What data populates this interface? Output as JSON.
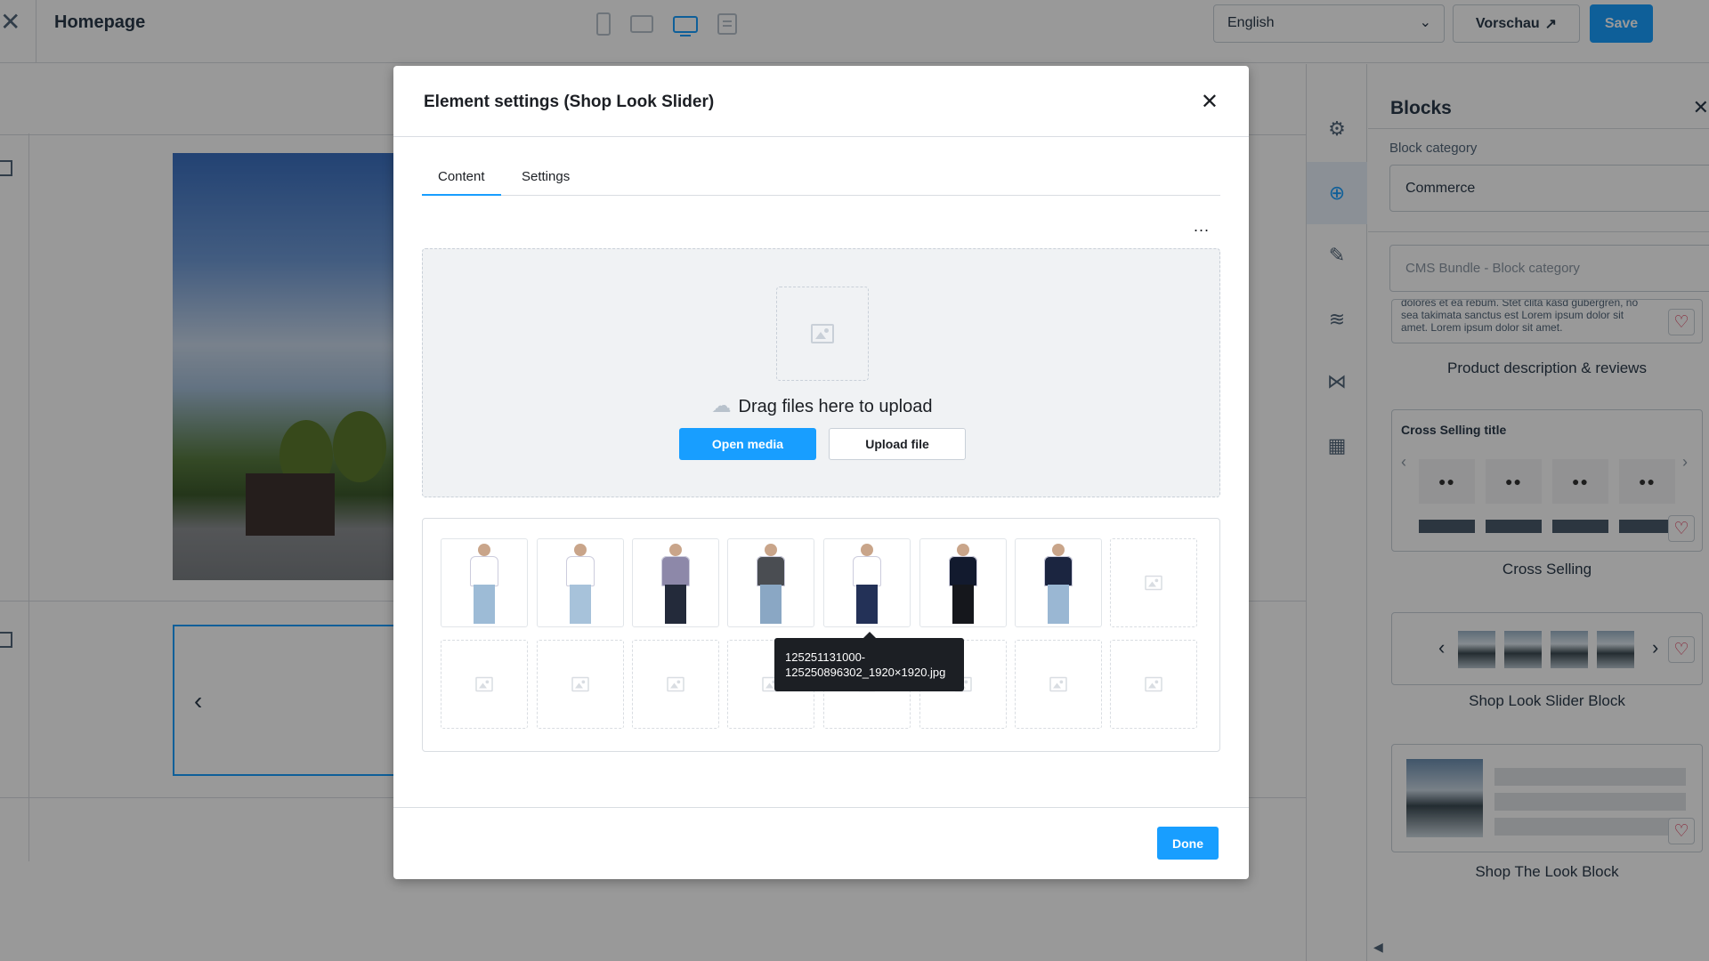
{
  "topbar": {
    "title": "Homepage",
    "language": "English",
    "preview_label": "Vorschau",
    "save_label": "Save"
  },
  "blocks": {
    "heading": "Blocks",
    "category_label": "Block category",
    "category_value": "Commerce",
    "sub_category_placeholder": "CMS Bundle - Block category",
    "lorem_snippet": "dolores et ea rebum. Stet clita kasd gubergren, no sea takimata sanctus est Lorem ipsum dolor sit amet. Lorem ipsum dolor sit amet.",
    "items": [
      {
        "name": "Product description & reviews"
      },
      {
        "name": "Cross Selling",
        "title": "Cross Selling title"
      },
      {
        "name": "Shop Look Slider Block"
      },
      {
        "name": "Shop The Look Block"
      }
    ]
  },
  "modal": {
    "title": "Element settings (Shop Look Slider)",
    "tabs": [
      "Content",
      "Settings"
    ],
    "active_tab": "Content",
    "more_label": "...",
    "dropzone_text": "Drag files here to upload",
    "open_media_label": "Open media",
    "upload_file_label": "Upload file",
    "tooltip_line1": "125251131000-",
    "tooltip_line2": "125250896302_1920×1920.jpg",
    "done_label": "Done",
    "gallery": [
      {
        "top": "#ffffff",
        "pants": "#9dbbd6"
      },
      {
        "top": "#ffffff",
        "pants": "#a7c2da"
      },
      {
        "top": "#8d88a9",
        "pants": "#232a3a"
      },
      {
        "top": "#4a4d52",
        "pants": "#8aa7c4"
      },
      {
        "top": "#ffffff",
        "pants": "#233157"
      },
      {
        "top": "#121a2e",
        "pants": "#15171c"
      },
      {
        "top": "#1b2540",
        "pants": "#9ab7d3"
      }
    ]
  },
  "colors": {
    "accent": "#189eff",
    "heart": "#de294c"
  }
}
